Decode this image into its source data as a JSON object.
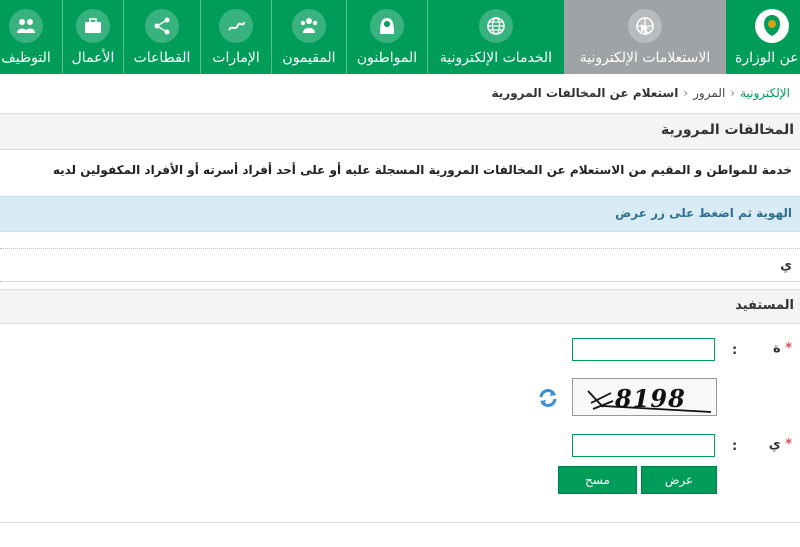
{
  "nav": {
    "items": [
      {
        "id": "jobs",
        "label": "التوظيف"
      },
      {
        "id": "business",
        "label": "الأعمال"
      },
      {
        "id": "sectors",
        "label": "القطاعات"
      },
      {
        "id": "emirates",
        "label": "الإمارات"
      },
      {
        "id": "residents",
        "label": "المقيمون"
      },
      {
        "id": "citizens",
        "label": "المواطنون"
      },
      {
        "id": "eservices",
        "label": "الخدمات الإلكترونية"
      },
      {
        "id": "einquiries",
        "label": "الاستعلامات الإلكترونية"
      },
      {
        "id": "ministry",
        "label": "عن الوزارة"
      }
    ],
    "active_index": 7,
    "colors": {
      "bar": "#009d5a",
      "active": "#9fa3a5"
    }
  },
  "breadcrumb": {
    "link": "الإلكترونية",
    "middle": "المرور",
    "current": "استعلام عن المخالفات المرورية"
  },
  "panel": {
    "title": "المخالفات المرورية"
  },
  "description": "خدمة للمواطن و المقيم من الاستعلام عن المخالفات المرورية المسجلة عليه أو على أحد أفراد أسرته أو الأفراد المكفولين لديه",
  "info": "الهوية ثم اضغط على زر عرض",
  "static_label": "ي",
  "section": {
    "title": "المستفيد"
  },
  "form": {
    "field1": {
      "label": "ة",
      "required_mark": "*",
      "value": ""
    },
    "captcha": {
      "text": "8198"
    },
    "field2": {
      "label": "ي",
      "required_mark": "*",
      "value": ""
    },
    "colon": ":"
  },
  "buttons": {
    "show": "عرض",
    "clear": "مسح"
  }
}
